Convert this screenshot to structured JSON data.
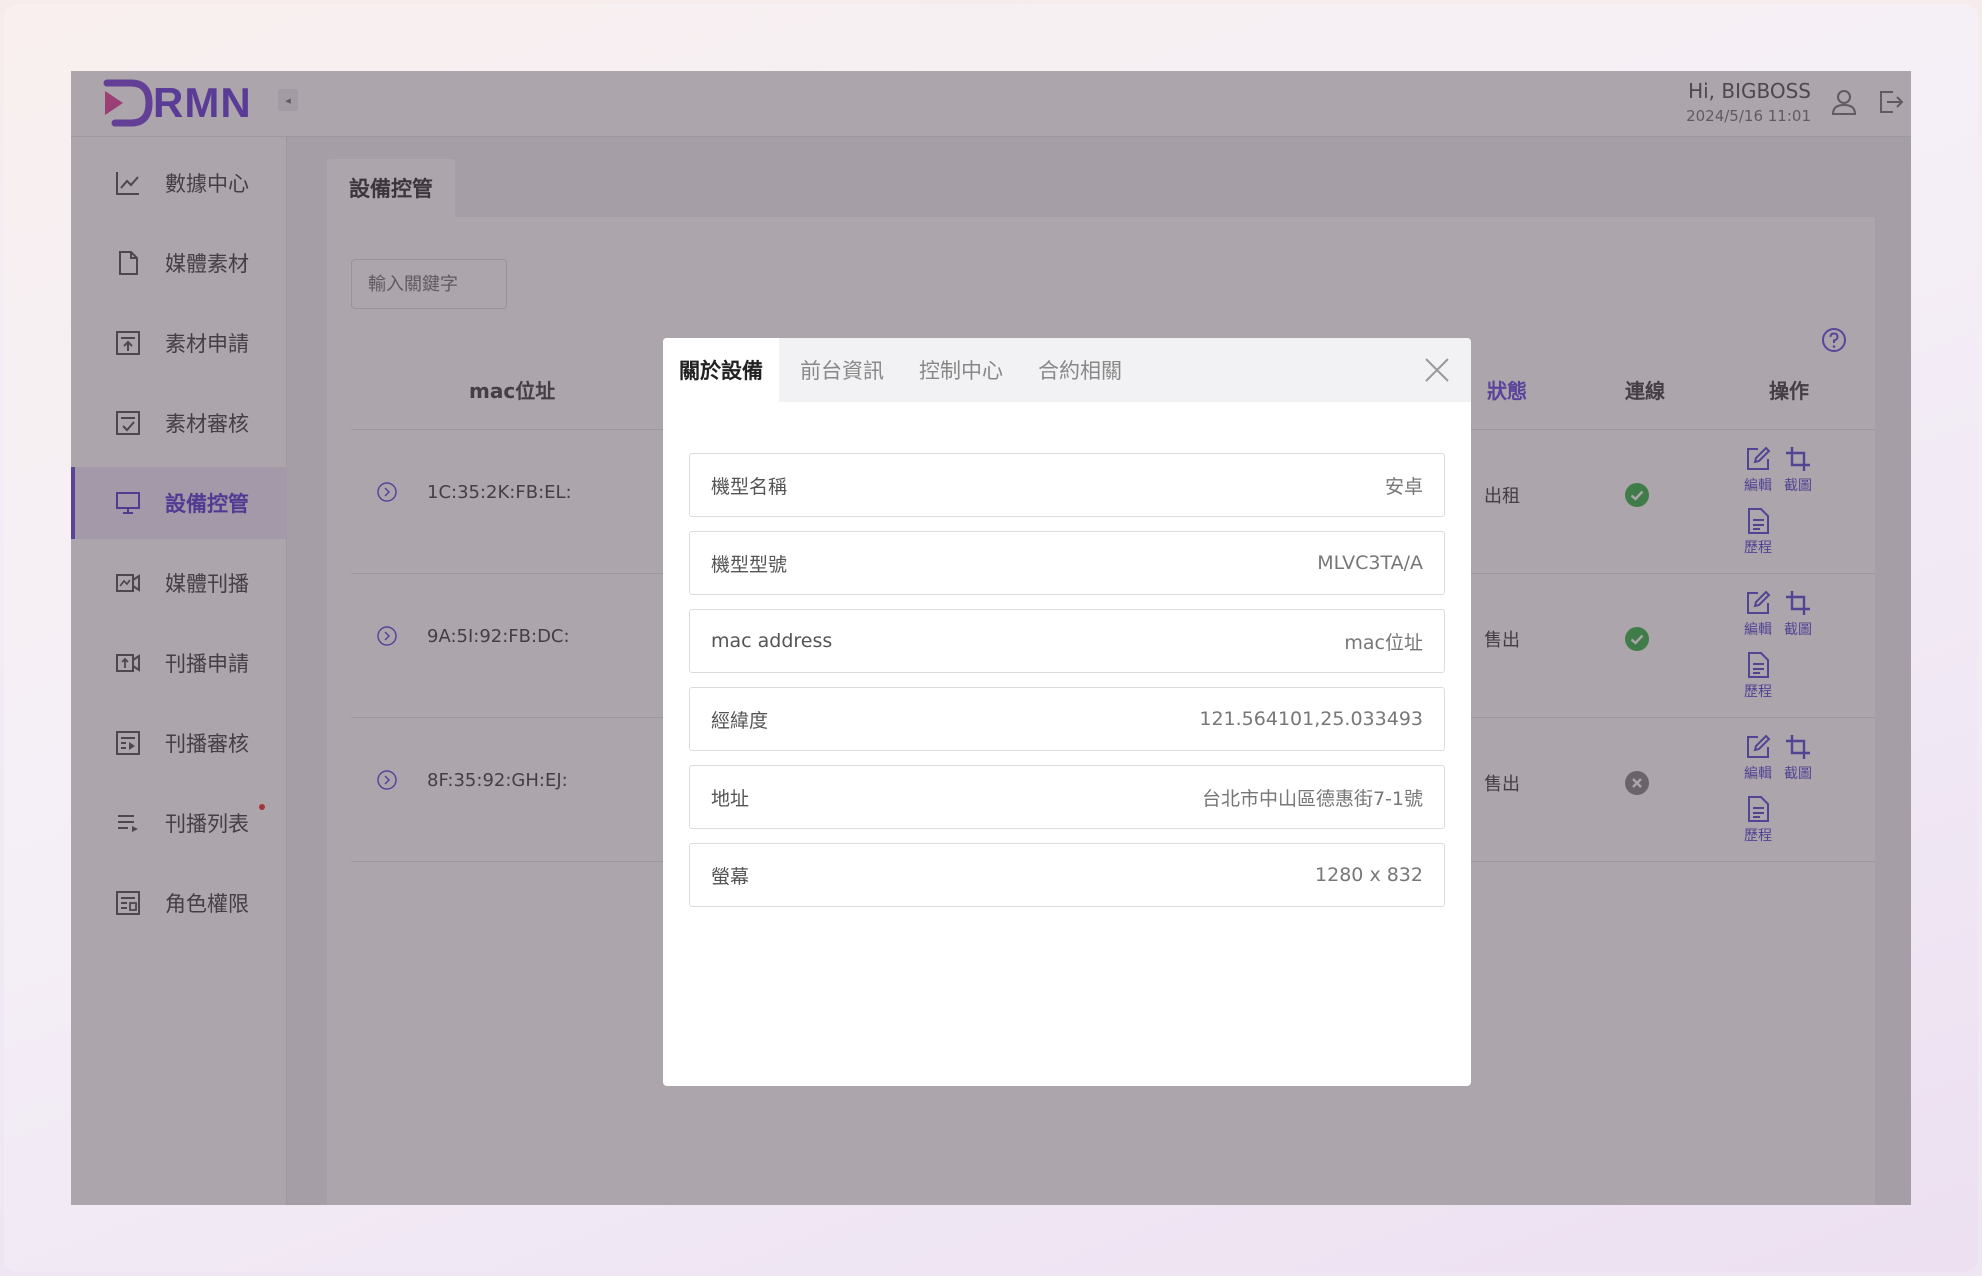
{
  "header": {
    "logo_text": "RMN",
    "greeting": "Hi, BIGBOSS",
    "datetime": "2024/5/16 11:01",
    "collapse_glyph": "◂",
    "icons": [
      "user-icon",
      "logout-icon"
    ]
  },
  "sidebar": {
    "items": [
      {
        "label": "數據中心",
        "icon": "chart-icon"
      },
      {
        "label": "媒體素材",
        "icon": "file-icon"
      },
      {
        "label": "素材申請",
        "icon": "form-upload-icon"
      },
      {
        "label": "素材審核",
        "icon": "form-check-icon"
      },
      {
        "label": "設備控管",
        "icon": "monitor-icon",
        "active": true
      },
      {
        "label": "媒體刊播",
        "icon": "media-icon"
      },
      {
        "label": "刊播申請",
        "icon": "video-upload-icon"
      },
      {
        "label": "刊播審核",
        "icon": "play-list-icon",
        "badge": true
      },
      {
        "label": "刊播列表",
        "icon": "list-icon"
      },
      {
        "label": "角色權限",
        "icon": "role-icon"
      }
    ]
  },
  "page": {
    "tab_label": "設備控管",
    "search_placeholder": "輸入關鍵字",
    "columns": {
      "mac": "mac位址",
      "status": "狀態",
      "connection": "連線",
      "actions": "操作"
    },
    "rows": [
      {
        "mac": "1C:35:2K:FB:EL:",
        "status": "出租",
        "online": true
      },
      {
        "mac": "9A:5I:92:FB:DC:",
        "status": "售出",
        "online": true
      },
      {
        "mac": "8F:35:92:GH:EJ:",
        "status": "售出",
        "online": false
      }
    ],
    "action_labels": {
      "edit": "編輯",
      "screenshot": "截圖",
      "history": "歷程"
    }
  },
  "modal": {
    "tabs": [
      "關於設備",
      "前台資訊",
      "控制中心",
      "合約相關"
    ],
    "active_tab": 0,
    "fields": [
      {
        "label": "機型名稱",
        "value": "安卓"
      },
      {
        "label": "機型型號",
        "value": "MLVC3TA/A"
      },
      {
        "label": "mac address",
        "value": "mac位址"
      },
      {
        "label": "經緯度",
        "value": "121.564101,25.033493"
      },
      {
        "label": "地址",
        "value": "台北市中山區德惠街7-1號"
      },
      {
        "label": "螢幕",
        "value": "1280 x 832"
      }
    ]
  },
  "colors": {
    "accent": "#6b4ee0",
    "online": "#3bb54a",
    "offline": "#888888",
    "overlay": "rgba(70,55,70,0.45)"
  }
}
